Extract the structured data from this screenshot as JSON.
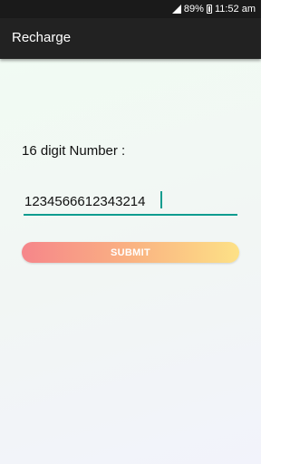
{
  "status_bar": {
    "battery": "89%",
    "time": "11:52 am",
    "signal_icon": "signal-icon",
    "battery_icon": "battery-icon"
  },
  "app_bar": {
    "title": "Recharge"
  },
  "form": {
    "label": "16 digit Number :",
    "number_value": "1234566612343214",
    "submit_label": "SUBMIT"
  },
  "colors": {
    "accent": "#0e9c8f",
    "app_bar": "#222222",
    "button_gradient_start": "#f6868a",
    "button_gradient_end": "#fde186"
  }
}
